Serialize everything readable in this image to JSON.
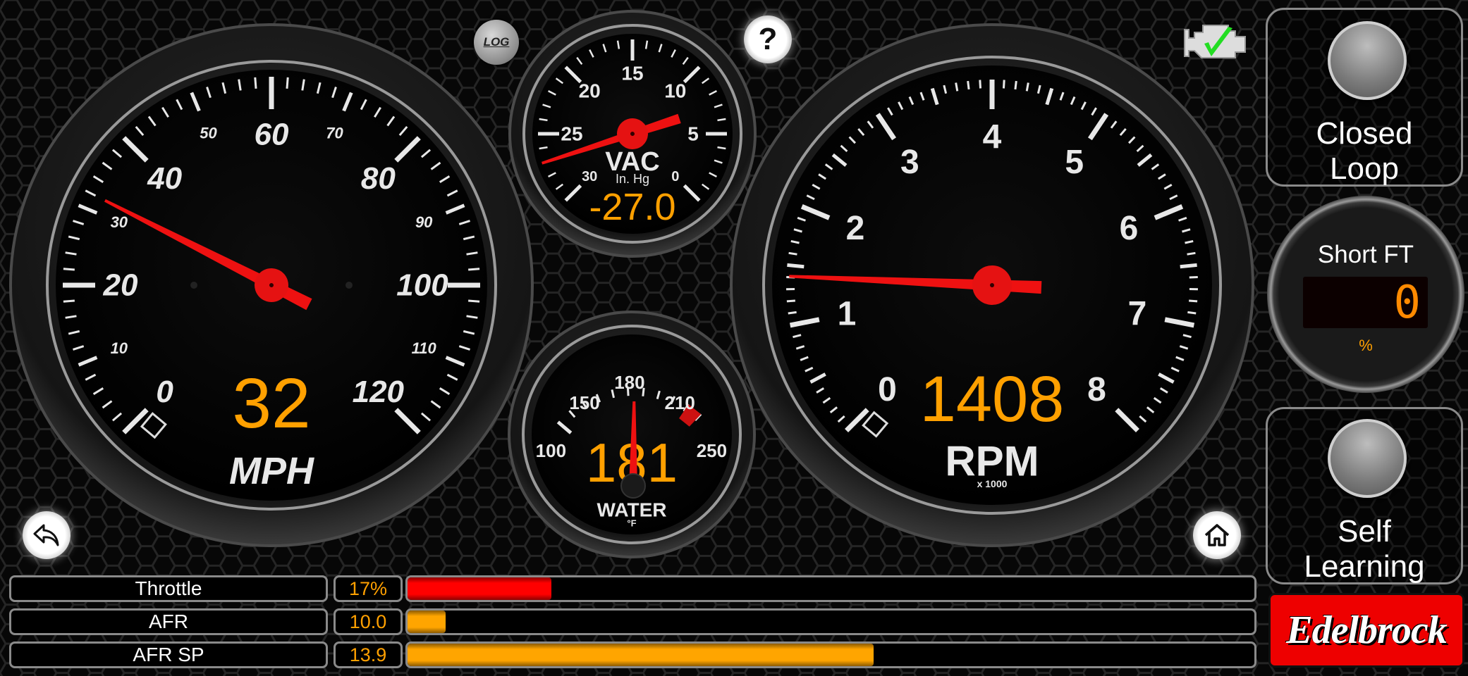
{
  "toolbar": {
    "log_label": "LOG",
    "help_label": "?"
  },
  "icons": {
    "back": "back-arrow-icon",
    "home": "home-icon",
    "engine_status": "check-engine-ok-icon",
    "log": "log-icon",
    "help": "help-icon"
  },
  "colors": {
    "readout": "#ffa000",
    "needle": "#ee1111",
    "throttle_bar": "#ff0000",
    "afr_bar": "#ffa500",
    "brand": "#ee0000",
    "engine_check": "#22dd22"
  },
  "gauges": {
    "speed": {
      "value": "32",
      "needle_value": 32,
      "min": 0,
      "max": 120,
      "unit_label": "MPH",
      "major_labels": [
        "0",
        "20",
        "40",
        "60",
        "80",
        "100",
        "120"
      ],
      "minor_labels": [
        "10",
        "30",
        "50",
        "70",
        "90",
        "110"
      ]
    },
    "vacuum": {
      "value": "-27.0",
      "needle_value": 27,
      "min": 0,
      "max": 30,
      "label": "VAC",
      "sublabel": "In. Hg",
      "tick_labels": [
        "0",
        "5",
        "10",
        "15",
        "20",
        "25",
        "30"
      ]
    },
    "water": {
      "value": "181",
      "needle_value": 181,
      "min": 100,
      "max": 250,
      "label": "WATER",
      "unit": "°F",
      "tick_labels": [
        "100",
        "150",
        "180",
        "210",
        "250"
      ]
    },
    "rpm": {
      "value": "1408",
      "needle_value": 1.408,
      "min": 0,
      "max": 8,
      "label": "RPM",
      "sublabel": "x 1000",
      "tick_labels": [
        "0",
        "1",
        "2",
        "3",
        "4",
        "5",
        "6",
        "7",
        "8"
      ]
    }
  },
  "side": {
    "closed_loop": {
      "line1": "Closed",
      "line2": "Loop"
    },
    "short_ft": {
      "title": "Short FT",
      "value": "0",
      "unit": "%"
    },
    "self_learning": {
      "line1": "Self",
      "line2": "Learning"
    }
  },
  "bars": [
    {
      "label": "Throttle",
      "value": "17%",
      "fill": 0.17,
      "color": "#ff0000"
    },
    {
      "label": "AFR",
      "value": "10.0",
      "fill": 0.045,
      "color": "#ffa500"
    },
    {
      "label": "AFR SP",
      "value": "13.9",
      "fill": 0.55,
      "color": "#ffa500"
    }
  ],
  "logo": "Edelbrock"
}
